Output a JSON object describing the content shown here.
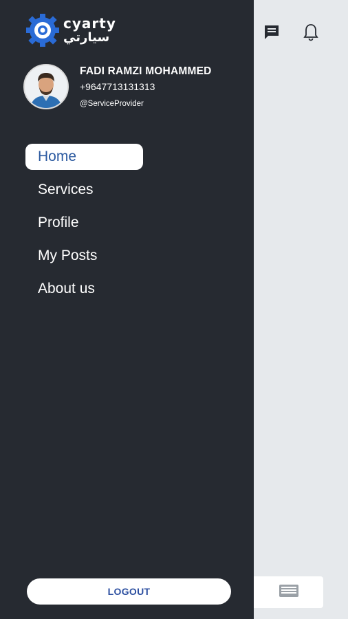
{
  "app": {
    "logo_text_en": "cyarty",
    "logo_text_ar": "سيارتي"
  },
  "profile": {
    "name": "FADI RAMZI MOHAMMED",
    "phone": "+9647713131313",
    "role": "@ServiceProvider"
  },
  "nav": {
    "items": [
      {
        "label": "Home",
        "active": true
      },
      {
        "label": "Services",
        "active": false
      },
      {
        "label": "Profile",
        "active": false
      },
      {
        "label": "My Posts",
        "active": false
      },
      {
        "label": "About us",
        "active": false
      }
    ]
  },
  "logout_label": "LOGOUT",
  "icons": {
    "chat": "chat-icon",
    "bell": "bell-icon",
    "list": "list-icon"
  },
  "colors": {
    "drawer_bg": "#262a31",
    "accent_blue": "#2c5aa0",
    "page_bg": "#e6e9ec"
  }
}
